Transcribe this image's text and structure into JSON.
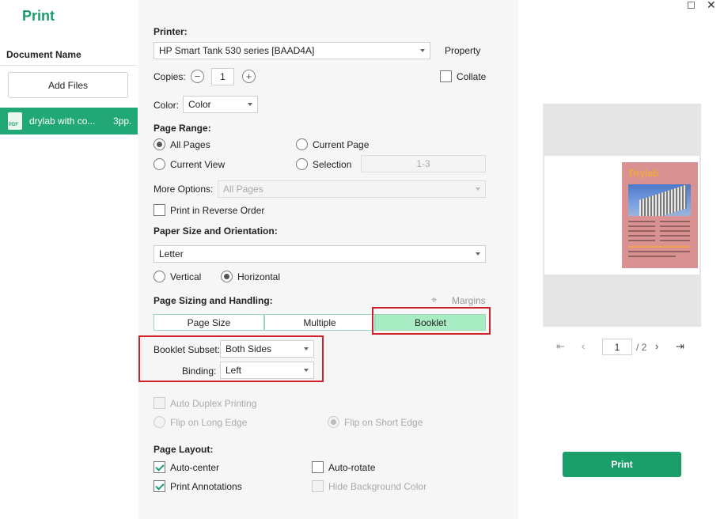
{
  "app": {
    "title": "Print"
  },
  "sidebar": {
    "header": "Document Name",
    "add_files": "Add Files",
    "documents": [
      {
        "name": "drylab with co...",
        "pages": "3pp.",
        "icon": "pdf-icon",
        "icon_label": "PDF"
      }
    ]
  },
  "settings": {
    "printer_label": "Printer:",
    "printer_value": "HP Smart Tank 530 series [BAAD4A]",
    "property_label": "Property",
    "copies_label": "Copies:",
    "copies_value": "1",
    "collate_label": "Collate",
    "collate_checked": false,
    "color_label": "Color:",
    "color_value": "Color",
    "page_range": {
      "label": "Page Range:",
      "all_pages": "All Pages",
      "current_page": "Current Page",
      "current_view": "Current View",
      "selection": "Selection",
      "selection_value": "1-3",
      "selected": "All Pages"
    },
    "more_options_label": "More Options:",
    "more_options_value": "All Pages",
    "reverse_order_label": "Print in Reverse Order",
    "paper": {
      "label": "Paper Size and Orientation:",
      "size_value": "Letter",
      "vertical": "Vertical",
      "horizontal": "Horizontal",
      "orientation": "Horizontal"
    },
    "sizing": {
      "label": "Page Sizing and Handling:",
      "margins_label": "Margins",
      "tabs": [
        "Page Size",
        "Multiple",
        "Booklet"
      ],
      "active_tab": "Booklet"
    },
    "booklet": {
      "subset_label": "Booklet Subset:",
      "subset_value": "Both Sides",
      "binding_label": "Binding:",
      "binding_value": "Left"
    },
    "duplex": {
      "auto_label": "Auto Duplex Printing",
      "long_edge": "Flip on Long Edge",
      "short_edge": "Flip on Short Edge"
    },
    "layout": {
      "label": "Page Layout:",
      "auto_center": "Auto-center",
      "auto_rotate": "Auto-rotate",
      "print_annotations": "Print Annotations",
      "hide_bg": "Hide Background Color"
    }
  },
  "preview": {
    "doc_title": "Drylab",
    "current_page": "1",
    "total_pages": "/ 2",
    "accent_color": "#1a9e6a"
  },
  "actions": {
    "print": "Print"
  },
  "colors": {
    "accent": "#1a9e6a",
    "highlight": "#d0202a",
    "active_tab": "#a8ecc3"
  }
}
